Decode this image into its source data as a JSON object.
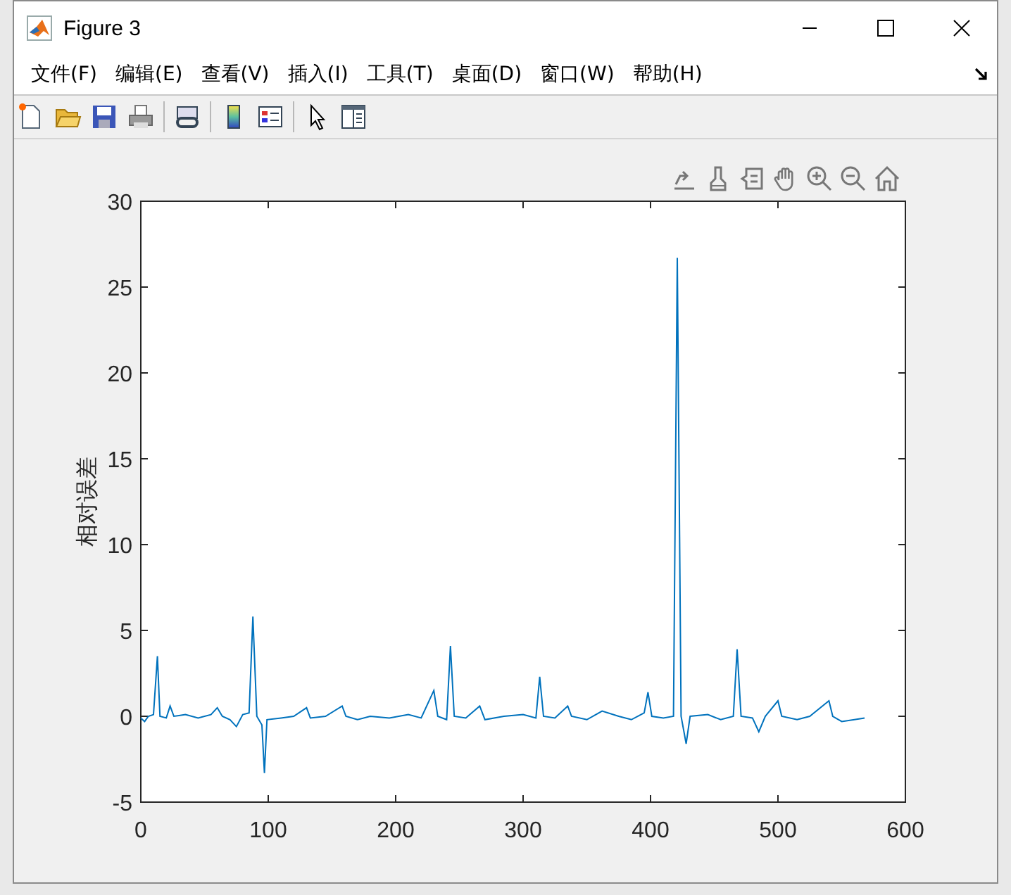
{
  "window": {
    "title": "Figure 3"
  },
  "menu": [
    "文件(F)",
    "编辑(E)",
    "查看(V)",
    "插入(I)",
    "工具(T)",
    "桌面(D)",
    "窗口(W)",
    "帮助(H)"
  ],
  "axes": {
    "chart_data": {
      "type": "line",
      "ylabel": "相对误差",
      "xlim": [
        0,
        600
      ],
      "ylim": [
        -5,
        30
      ],
      "xticks": [
        0,
        100,
        200,
        300,
        400,
        500,
        600
      ],
      "yticks": [
        -5,
        0,
        5,
        10,
        15,
        20,
        25,
        30
      ],
      "x": [
        0,
        3,
        6,
        10,
        13,
        15,
        20,
        23,
        26,
        35,
        45,
        55,
        60,
        64,
        70,
        75,
        80,
        85,
        88,
        91,
        95,
        97,
        99,
        110,
        120,
        130,
        133,
        145,
        158,
        161,
        170,
        180,
        195,
        210,
        220,
        230,
        233,
        240,
        243,
        246,
        255,
        266,
        270,
        285,
        300,
        310,
        313,
        316,
        325,
        335,
        338,
        350,
        362,
        375,
        385,
        395,
        398,
        401,
        410,
        418,
        421,
        424,
        428,
        431,
        445,
        455,
        465,
        468,
        471,
        480,
        485,
        490,
        500,
        503,
        515,
        525,
        540,
        543,
        550,
        560,
        568
      ],
      "series": [
        {
          "color": "#0072bd",
          "values": [
            -0.1,
            -0.3,
            0,
            0.1,
            3.5,
            0,
            -0.1,
            0.6,
            0,
            0.1,
            -0.1,
            0.1,
            0.5,
            0,
            -0.2,
            -0.6,
            0.1,
            0.2,
            5.8,
            0,
            -0.5,
            -3.3,
            -0.2,
            -0.1,
            0,
            0.5,
            -0.1,
            0,
            0.6,
            0,
            -0.2,
            0,
            -0.1,
            0.1,
            -0.1,
            1.5,
            0,
            -0.2,
            4.1,
            0,
            -0.1,
            0.6,
            -0.2,
            0,
            0.1,
            -0.1,
            2.3,
            0,
            -0.1,
            0.6,
            0,
            -0.2,
            0.3,
            0,
            -0.2,
            0.2,
            1.4,
            0,
            -0.1,
            0,
            26.7,
            0,
            -1.6,
            0,
            0.1,
            -0.2,
            0,
            3.9,
            0,
            -0.1,
            -0.9,
            0,
            0.9,
            0,
            -0.2,
            0,
            0.9,
            0,
            -0.3,
            -0.2,
            -0.1
          ]
        }
      ]
    }
  }
}
